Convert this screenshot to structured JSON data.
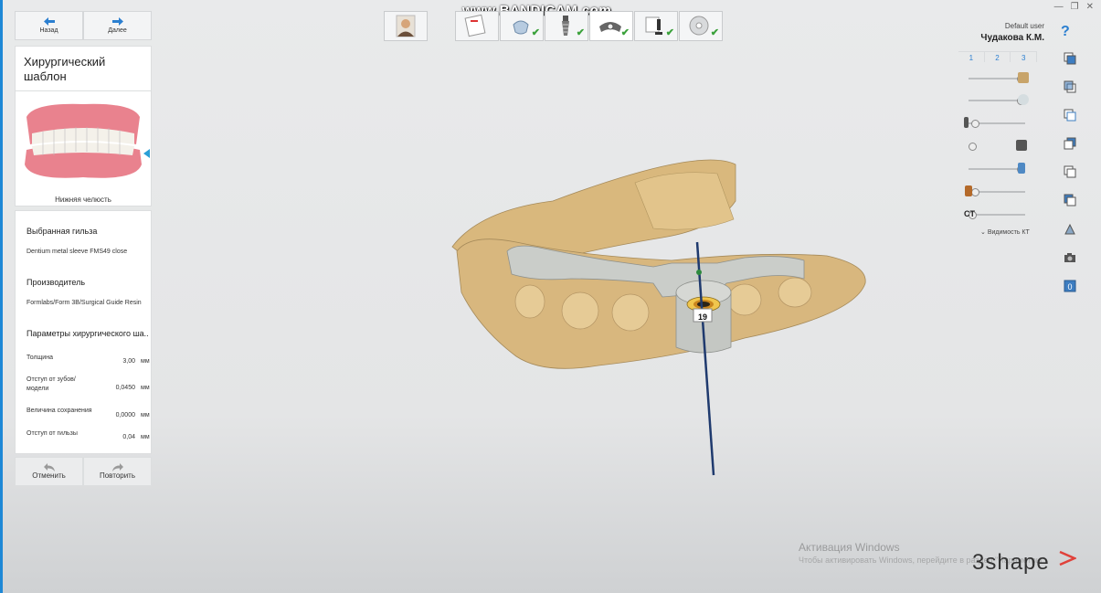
{
  "watermark": "www.BANDICAM.com",
  "nav": {
    "back": "Назад",
    "next": "Далее"
  },
  "panel": {
    "title": "Хирургический шаблон",
    "jaw_caption": "Нижняя челюсть",
    "sleeve_title": "Выбранная гильза",
    "sleeve_value": "Dentium metal sleeve FMS49 close",
    "manufacturer_title": "Производитель",
    "manufacturer_value": "Formlabs/Form 3B/Surgical Guide Resin",
    "params_title": "Параметры хирургического ша...",
    "params": [
      {
        "label": "Толщина",
        "value": "3,00",
        "unit": "мм"
      },
      {
        "label": "Отступ от зубов/ модели",
        "value": "0,0450",
        "unit": "мм"
      },
      {
        "label": "Величина сохранения",
        "value": "0,0000",
        "unit": "мм"
      },
      {
        "label": "Отступ от гильзы",
        "value": "0,04",
        "unit": "мм"
      }
    ]
  },
  "undo": {
    "undo": "Отменить",
    "redo": "Повторить"
  },
  "user": {
    "role": "Default user",
    "name": "Чудакова К.М."
  },
  "help_label": "?",
  "view_tabs": [
    "1",
    "2",
    "3"
  ],
  "visibility": {
    "ct_label": "CT",
    "toggle_label": "Видимость КТ",
    "levels": [
      0.95,
      0.95,
      0.05,
      0.0,
      0.95,
      0.05,
      0.0
    ]
  },
  "implant_label": "19",
  "activation": {
    "title": "Активация Windows",
    "subtitle": "Чтобы активировать Windows, перейдите в раздел \"Параметры\"."
  },
  "logo": "3shape",
  "colors": {
    "accent": "#2b7fd0",
    "model": "#d8b77e",
    "guide": "#c9ccc9",
    "check": "#3aa13a"
  }
}
